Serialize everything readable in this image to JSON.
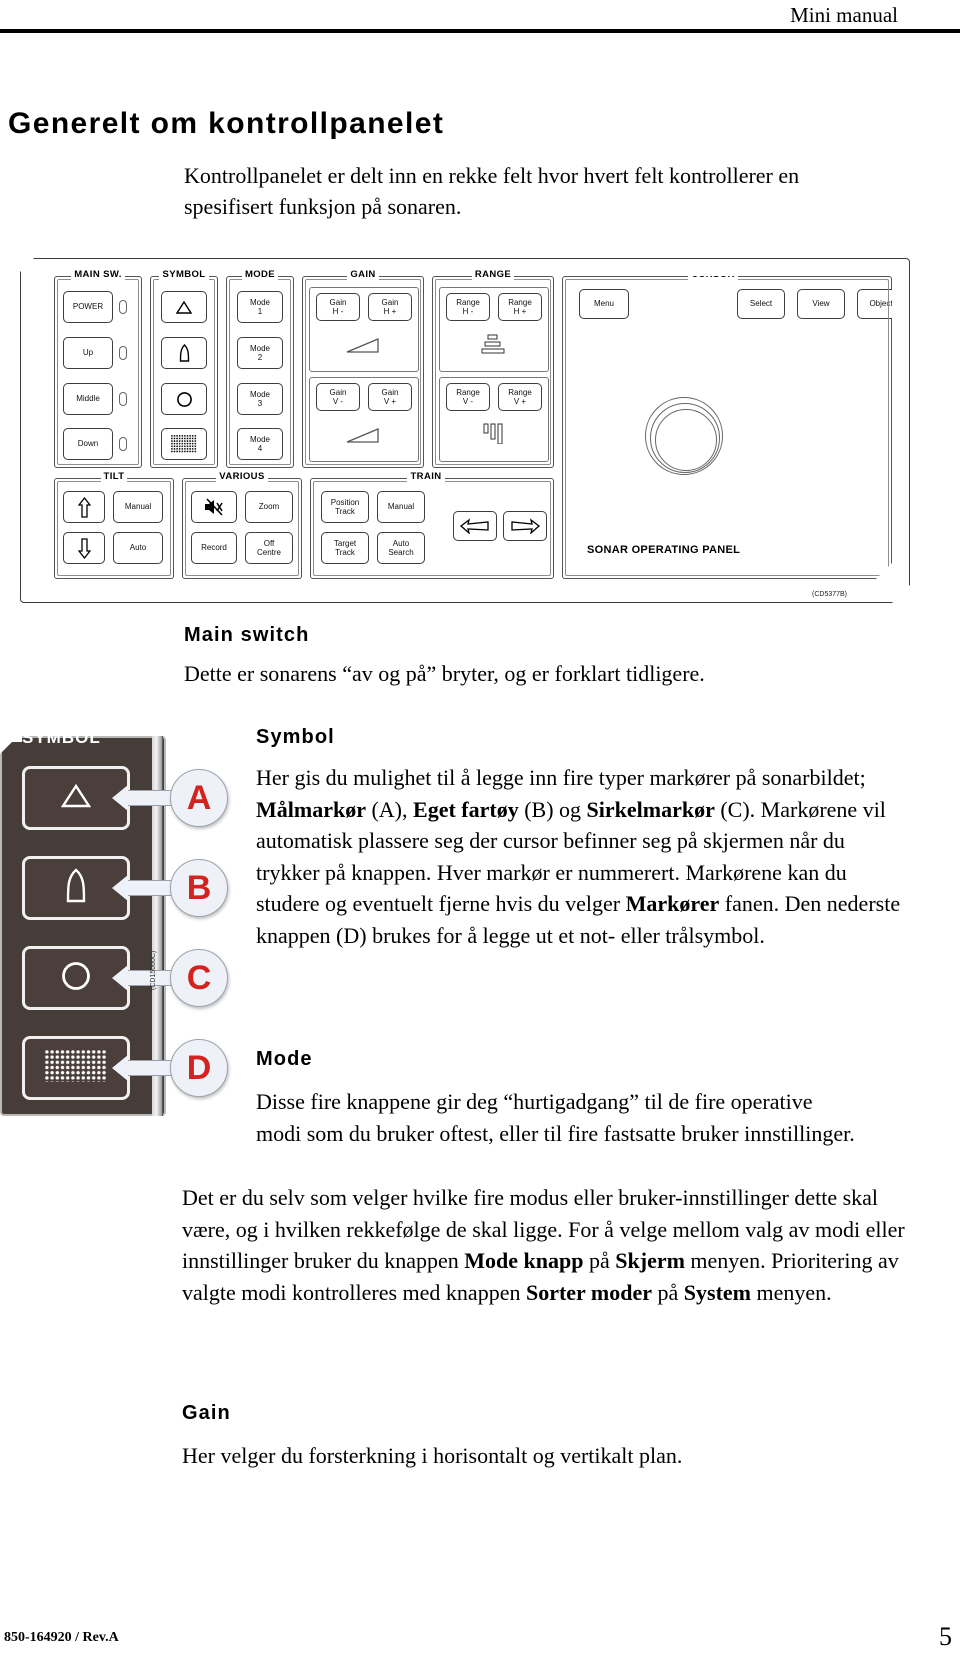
{
  "header": {
    "title": "Mini manual"
  },
  "page_title": "Generelt om kontrollpanelet",
  "intro": "Kontrollpanelet er delt inn en rekke felt hvor hvert felt kontrollerer en spesifisert funksjon på sonaren.",
  "panel": {
    "name": "SONAR OPERATING PANEL",
    "drawing_code": "(CD5377B)",
    "groups": {
      "main_sw": {
        "label": "MAIN SW.",
        "keys": [
          "POWER",
          "Up",
          "Middle",
          "Down"
        ]
      },
      "symbol": {
        "label": "SYMBOL",
        "keys": [
          "triangle-symbol",
          "vessel-symbol",
          "circle-symbol",
          "net-symbol"
        ]
      },
      "mode": {
        "label": "MODE",
        "keys": [
          "Mode\n1",
          "Mode\n2",
          "Mode\n3",
          "Mode\n4"
        ]
      },
      "gain": {
        "label": "GAIN",
        "keys": [
          "Gain\nH -",
          "Gain\nH +",
          "Gain\nV -",
          "Gain\nV +"
        ]
      },
      "range": {
        "label": "RANGE",
        "keys": [
          "Range\nH -",
          "Range\nH +",
          "Range\nV -",
          "Range\nV +"
        ]
      },
      "cursor": {
        "label": "CURSOR",
        "keys": [
          "Menu",
          "Select",
          "View",
          "Object"
        ]
      },
      "tilt": {
        "label": "TILT",
        "keys": [
          "arrow-up-icon",
          "Manual",
          "arrow-down-icon",
          "Auto"
        ]
      },
      "various": {
        "label": "VARIOUS",
        "keys": [
          "mute-icon",
          "Zoom",
          "Record",
          "Off\nCentre"
        ]
      },
      "train": {
        "label": "TRAIN",
        "keys": [
          "Position\nTrack",
          "Manual",
          "Target\nTrack",
          "Auto\nSearch",
          "train-left-icon",
          "train-right-icon"
        ]
      }
    }
  },
  "sections": [
    {
      "heading": "Main switch",
      "paragraphs": [
        "Dette er sonarens “av og på” bryter, og er forklart tidligere."
      ]
    },
    {
      "heading": "Symbol",
      "paragraphs": [
        "Her gis du mulighet til å legge inn fire typer markører på sonarbildet; Målmarkør (A), Eget fartøy (B) og Sirkelmarkør (C). Markørene vil automatisk plassere seg der cursor befinner seg på skjermen når du trykker på knappen. Hver markør er nummerert. Markørene kan du studere og eventuelt fjerne hvis du velger Markører fanen. Den nederste knappen (D) brukes for å legge ut et not- eller trålsymbol."
      ]
    },
    {
      "heading": "Mode",
      "paragraphs": [
        "Disse fire knappene gir deg “hurtigadgang” til de fire operative modi som du bruker oftest, eller til fire fastsatte bruker innstillinger.",
        "Det er du selv som velger hvilke fire modus eller bruker-innstillinger dette skal være, og i hvilken rekkefølge de skal ligge. For å velge mellom valg av modi eller innstillinger bruker du knappen Mode knapp på Skjerm menyen. Prioritering av valgte modi kontrolleres med knappen Sorter moder på System menyen."
      ]
    },
    {
      "heading": "Gain",
      "paragraphs": [
        "Her velger du forsterkning i horisontalt og vertikalt plan."
      ]
    }
  ],
  "symbol_figure": {
    "title": "SYMBOL",
    "code": "(CD15060C)",
    "callouts": [
      "A",
      "B",
      "C",
      "D"
    ]
  },
  "footer": {
    "left": "850-164920 / Rev.A",
    "page_number": "5"
  },
  "colors": {
    "callout_red": "#d2231f",
    "panel_dark": "#463c38",
    "rule": "#000000"
  }
}
